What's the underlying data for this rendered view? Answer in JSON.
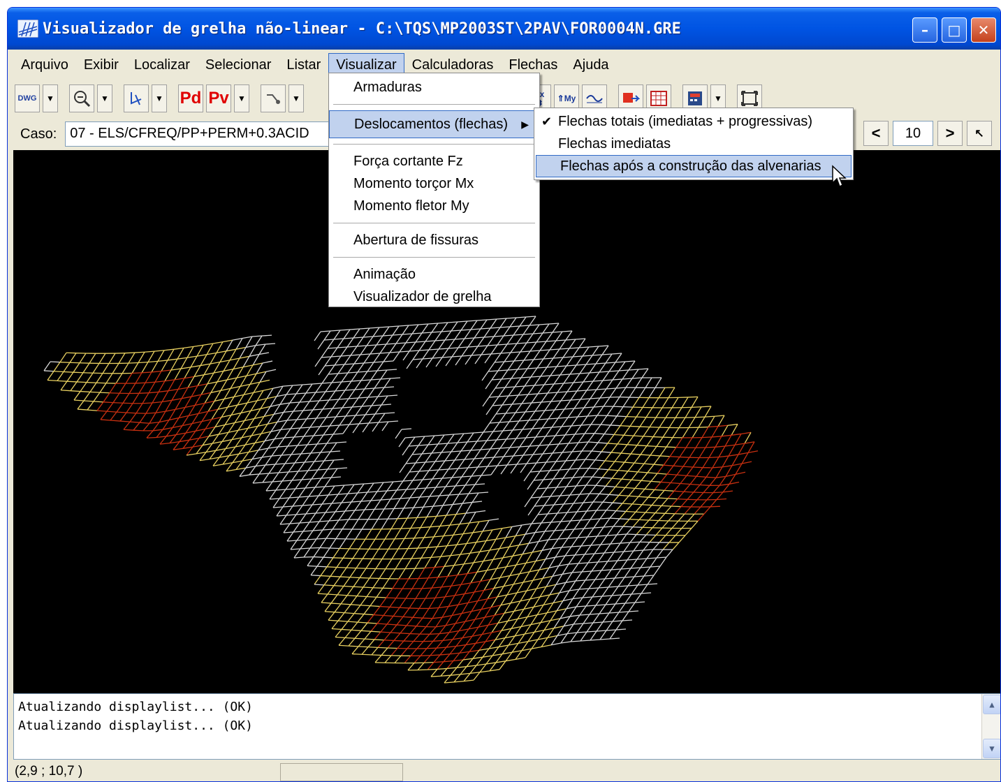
{
  "window": {
    "title": "Visualizador de grelha não-linear - C:\\TQS\\MP2003ST\\2PAV\\FOR0004N.GRE",
    "icon": "tqs-grid-icon",
    "controls": {
      "minimize": "minimize-icon",
      "maximize": "maximize-icon",
      "close": "close-icon"
    }
  },
  "menubar": [
    {
      "label": "Arquivo"
    },
    {
      "label": "Exibir"
    },
    {
      "label": "Localizar"
    },
    {
      "label": "Selecionar"
    },
    {
      "label": "Listar"
    },
    {
      "label": "Visualizar",
      "active": true
    },
    {
      "label": "Calculadoras"
    },
    {
      "label": "Flechas"
    },
    {
      "label": "Ajuda"
    }
  ],
  "toolbar": {
    "dwg_label": "DWG",
    "pd_label": "Pd",
    "pv_label": "Pv",
    "mx_label": "Mx",
    "my_label": "My"
  },
  "casebar": {
    "label": "Caso:",
    "value": "07 - ELS/CFREQ/PP+PERM+0.3ACID",
    "page": "10",
    "prev": "<",
    "next": ">"
  },
  "visualizar_menu": {
    "items": [
      {
        "label": "Armaduras"
      },
      {
        "label": "Deslocamentos (flechas)",
        "submenu": true,
        "highlighted": true
      },
      {
        "label": "Força cortante Fz"
      },
      {
        "label": "Momento torçor Mx"
      },
      {
        "label": "Momento fletor My"
      },
      {
        "label": "Abertura de fissuras"
      },
      {
        "label": "Animação"
      },
      {
        "label": "Visualizador de grelha"
      }
    ]
  },
  "submenu": {
    "items": [
      {
        "label": "Flechas totais (imediatas + progressivas)",
        "checked": true
      },
      {
        "label": "Flechas imediatas"
      },
      {
        "label": "Flechas após a construção das alvenarias",
        "highlighted": true
      }
    ]
  },
  "log": {
    "lines": [
      "Atualizando displaylist... (OK)",
      "Atualizando displaylist... (OK)"
    ]
  },
  "status": {
    "coordinates": "(2,9 ; 10,7 )"
  },
  "colors": {
    "grid_white": "#d8d8d8",
    "grid_yellow": "#e8d060",
    "grid_red": "#c83010",
    "title_blue": "#0054e3",
    "highlight": "#c1d2ee"
  }
}
